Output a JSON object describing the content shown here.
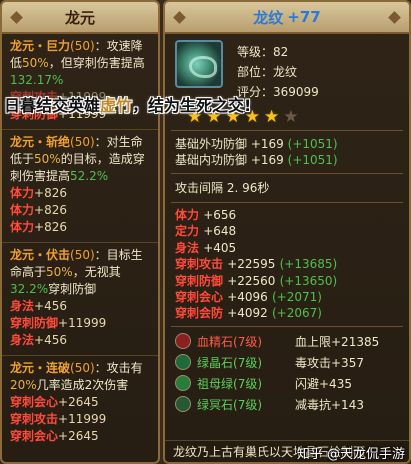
{
  "left_panel": {
    "title": "龙元",
    "skills": [
      {
        "name": "龙元・巨力",
        "level": "(50)",
        "text_a": "：攻速降低",
        "pct_a": "50%",
        "text_b": "，但穿刺伤害提高",
        "pct_b": "132.17%",
        "stats": [
          {
            "label": "穿刺攻击",
            "value": "+11999",
            "dim": true
          },
          {
            "label": "穿刺防御",
            "value": "+11999"
          }
        ]
      },
      {
        "name": "龙元・斩绝",
        "level": "(50)",
        "text_a": "：对生命低于",
        "pct_a": "50%",
        "text_b": "的目标，造成穿刺伤害提高",
        "pct_b": "52.2%",
        "stats": [
          {
            "label": "体力",
            "value": "+826"
          },
          {
            "label": "体力",
            "value": "+826"
          },
          {
            "label": "体力",
            "value": "+826"
          }
        ]
      },
      {
        "name": "龙元・伏击",
        "level": "(50)",
        "text_a": "：目标生命高于",
        "pct_a": "50%",
        "text_b": "，无视其",
        "pct_b": "32.2%",
        "text_c": "穿刺防御",
        "stats": [
          {
            "label": "身法",
            "value": "+456"
          },
          {
            "label": "穿刺防御",
            "value": "+11999"
          },
          {
            "label": "身法",
            "value": "+456"
          }
        ]
      },
      {
        "name": "龙元・连破",
        "level": "(50)",
        "text_a": "：攻击有",
        "pct_a": "20%",
        "text_b": "几率造成2次伤害",
        "stats": [
          {
            "label": "穿刺会心",
            "value": "+2645"
          },
          {
            "label": "穿刺攻击",
            "value": "+11999"
          },
          {
            "label": "穿刺会心",
            "value": "+2645"
          }
        ]
      }
    ]
  },
  "overlay_caption": {
    "before": "日暮结交英雄",
    "name": "虚竹",
    "after": "，结为生死之交!"
  },
  "right_panel": {
    "title": "龙纹",
    "level": "+77",
    "info": {
      "grade": "等级：82",
      "slot": "部位：龙纹",
      "score": "评分：369099"
    },
    "stars": [
      true,
      true,
      true,
      true,
      true,
      false
    ],
    "base": [
      {
        "label": "基础外功防御",
        "value": "+169",
        "bonus": "(+1051)"
      },
      {
        "label": "基础内功防御",
        "value": "+169",
        "bonus": "(+1051)"
      }
    ],
    "attack_interval": "攻击间隔 2. 96秒",
    "attrs": [
      {
        "label": "体力",
        "value": "+656"
      },
      {
        "label": "定力",
        "value": "+648"
      },
      {
        "label": "身法",
        "value": "+405"
      },
      {
        "label": "穿刺攻击",
        "value": "+22595",
        "bonus": "(+13685)"
      },
      {
        "label": "穿刺防御",
        "value": "+22560",
        "bonus": "(+13650)"
      },
      {
        "label": "穿刺会心",
        "value": "+4096",
        "bonus": "(+2071)"
      },
      {
        "label": "穿刺会防",
        "value": "+4092",
        "bonus": "(+2067)"
      }
    ],
    "gems": [
      {
        "icon": "blood-gem-icon",
        "name": "血精石",
        "level": "(7级)",
        "color": "red",
        "effect": "血上限+21385"
      },
      {
        "icon": "green-crystal-icon",
        "name": "绿晶石",
        "level": "(7级)",
        "color": "green",
        "effect": "毒攻击+357"
      },
      {
        "icon": "emerald-icon",
        "name": "祖母绿",
        "level": "(7级)",
        "color": "green",
        "effect": "闪避+435"
      },
      {
        "icon": "green-ghost-stone-icon",
        "name": "绿冥石",
        "level": "(7级)",
        "color": "green",
        "effect": "减毒抗+143"
      }
    ],
    "footer": "龙纹乃上古有巢氏以天地晶石绘制而"
  },
  "watermark": "知乎 @天龙侃手游"
}
